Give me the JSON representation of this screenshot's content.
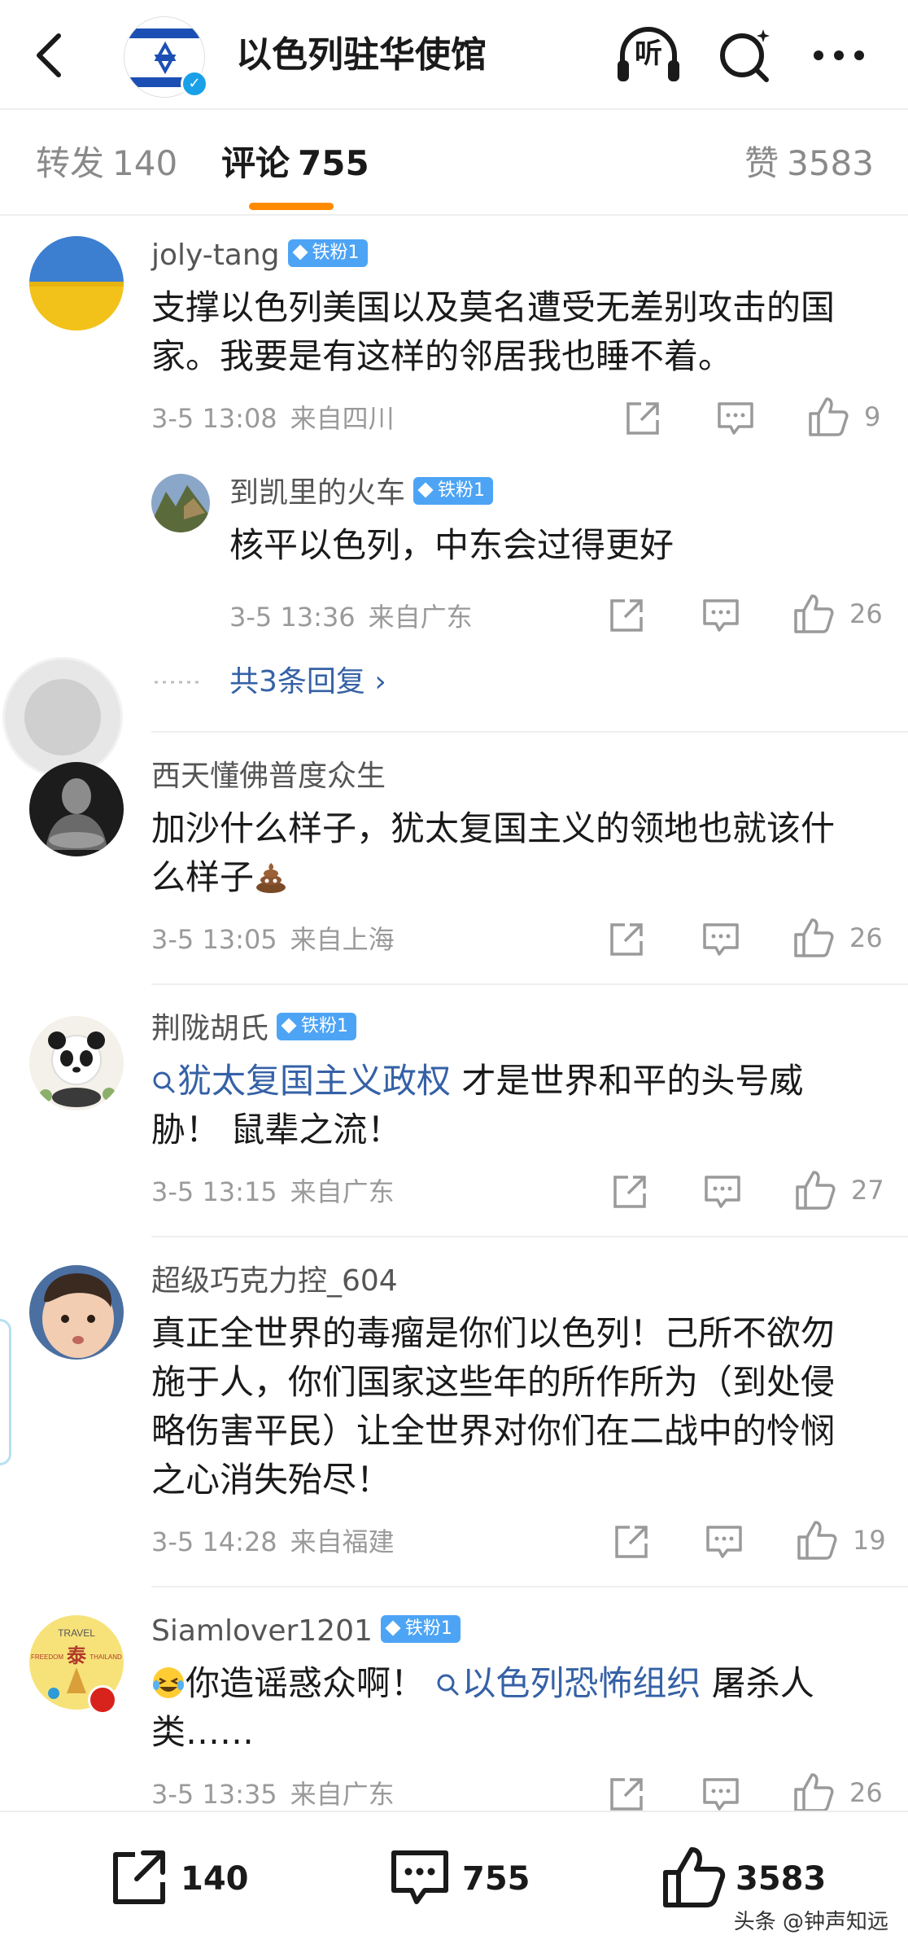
{
  "header": {
    "title": "以色列驻华使馆",
    "listen_label": "听"
  },
  "tabs": {
    "repost": {
      "label": "转发",
      "count": "140"
    },
    "comments": {
      "label": "评论",
      "count": "755"
    },
    "likes": {
      "label": "赞",
      "count": "3583"
    }
  },
  "comments": [
    {
      "name": "joly-tang",
      "badge": "铁粉1",
      "text": "支撑以色列美国以及莫名遭受无差别攻击的国家。我要是有这样的邻居我也睡不着。",
      "time": "3-5 13:08",
      "place": "来自四川",
      "likes": "9",
      "reply": {
        "name": "到凯里的火车",
        "badge": "铁粉1",
        "text": "核平以色列，中东会过得更好",
        "time": "3-5 13:36",
        "place": "来自广东",
        "likes": "26"
      },
      "more_replies": "共3条回复 ›"
    },
    {
      "name": "西天懂佛普度众生",
      "text": "加沙什么样子，犹太复国主义的领地也就该什么样子",
      "time": "3-5 13:05",
      "place": "来自上海",
      "likes": "26"
    },
    {
      "name": "荆陇胡氏",
      "badge": "铁粉1",
      "topic": "犹太复国主义政权",
      "text_after_topic": " 才是世界和平的头号威胁！ 鼠辈之流！",
      "time": "3-5 13:15",
      "place": "来自广东",
      "likes": "27"
    },
    {
      "name": "超级巧克力控_604",
      "text": "真正全世界的毒瘤是你们以色列！己所不欲勿施于人，你们国家这些年的所作所为（到处侵略伤害平民）让全世界对你们在二战中的怜悯之心消失殆尽！",
      "time": "3-5 14:28",
      "place": "来自福建",
      "likes": "19"
    },
    {
      "name": "Siamlover1201",
      "badge": "铁粉1",
      "text_before_topic": "你造谣惑众啊！ ",
      "topic": "以色列恐怖组织",
      "text_after_topic": " 屠杀人类……",
      "time": "3-5 13:35",
      "place": "来自广东",
      "likes": "26",
      "avatar_text": {
        "top": "TRAVEL",
        "left": "FREEDOM",
        "center": "泰",
        "right": "THAILAND"
      }
    }
  ],
  "bottom_bar": {
    "repost_count": "140",
    "comment_count": "755",
    "like_count": "3583"
  },
  "watermark": "头条 @钟声知远",
  "colors": {
    "accent": "#ff8a00",
    "link": "#3561a6",
    "badge": "#4da4f5",
    "verified": "#1aa0e8"
  }
}
